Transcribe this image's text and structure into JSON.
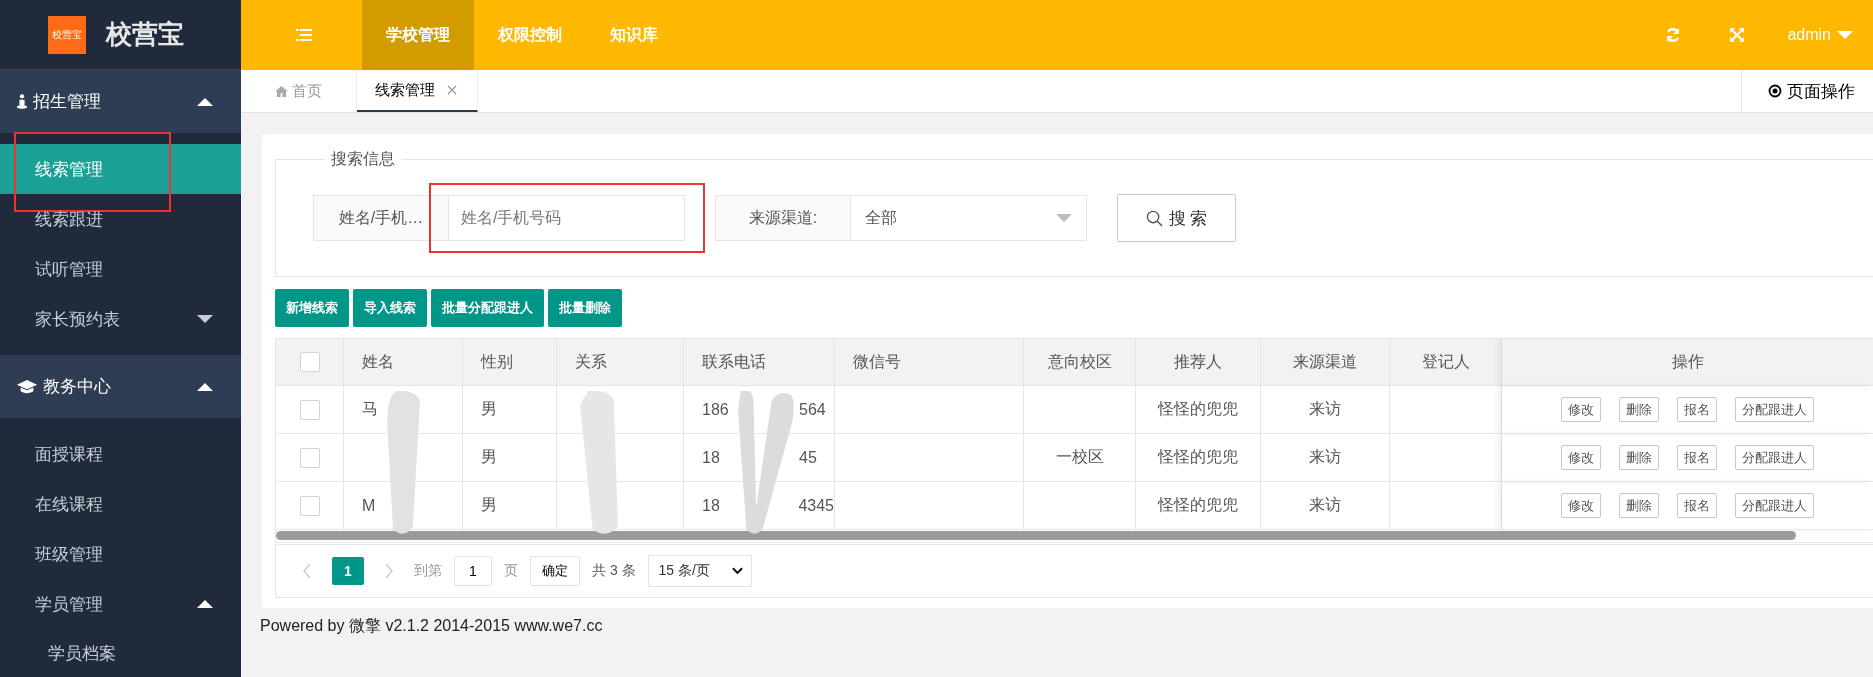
{
  "logo": {
    "badge": "校营宝",
    "title": "校营宝"
  },
  "sidebar": {
    "groups": [
      {
        "label": "招生管理",
        "expanded": true,
        "items": [
          {
            "label": "线索管理",
            "selected": true,
            "highlighted": true
          },
          {
            "label": "线索跟进",
            "selected": false
          },
          {
            "label": "试听管理",
            "selected": false
          },
          {
            "label": "家长预约表",
            "selected": false,
            "expanded": false
          }
        ]
      },
      {
        "label": "教务中心",
        "expanded": true,
        "items": [
          {
            "label": "面授课程",
            "selected": false
          },
          {
            "label": "在线课程",
            "selected": false
          },
          {
            "label": "班级管理",
            "selected": false
          },
          {
            "label": "学员管理",
            "selected": false,
            "expanded": true,
            "children": [
              {
                "label": "学员档案",
                "selected": false
              }
            ]
          }
        ]
      }
    ]
  },
  "top_nav": {
    "items": [
      {
        "label": "学校管理",
        "selected": true
      },
      {
        "label": "权限控制",
        "selected": false
      },
      {
        "label": "知识库",
        "selected": false
      }
    ],
    "user": "admin"
  },
  "tabs": [
    {
      "label": "首页",
      "selected": false,
      "closable": false
    },
    {
      "label": "线索管理",
      "selected": true,
      "closable": true
    }
  ],
  "page_actions": "页面操作",
  "search": {
    "legend": "搜索信息",
    "name_label": "姓名/手机…",
    "name_placeholder": "姓名/手机号码",
    "name_highlighted": true,
    "source_label": "来源渠道:",
    "source_value": "全部",
    "button": "搜 索"
  },
  "actions": [
    "新增线索",
    "导入线索",
    "批量分配跟进人",
    "批量删除"
  ],
  "table": {
    "all_checked": false,
    "columns": [
      "姓名",
      "性别",
      "关系",
      "联系电话",
      "微信号",
      "意向校区",
      "推荐人",
      "来源渠道",
      "登记人",
      "操作"
    ],
    "rows": [
      {
        "checked": false,
        "name": "马",
        "gender": "男",
        "phone_head": "186",
        "phone_tail": "564",
        "referrer": "怪怪的兜兜",
        "source": "来访",
        "ops": [
          "修改",
          "删除",
          "报名",
          "分配跟进人"
        ]
      },
      {
        "checked": false,
        "gender": "男",
        "phone_head": "18",
        "phone_tail": "45",
        "campus": "一校区",
        "referrer": "怪怪的兜兜",
        "source": "来访",
        "ops": [
          "修改",
          "删除",
          "报名",
          "分配跟进人"
        ]
      },
      {
        "checked": false,
        "name": "M",
        "gender": "男",
        "phone_head": "18",
        "phone_tail": "4345",
        "referrer": "怪怪的兜兜",
        "source": "来访",
        "ops": [
          "修改",
          "删除",
          "报名",
          "分配跟进人"
        ]
      }
    ]
  },
  "pagination": {
    "pages": [
      {
        "label": "1",
        "selected": true
      }
    ],
    "goto_label": "到第",
    "goto_value": "1",
    "page_unit": "页",
    "confirm": "确定",
    "total": "共 3 条",
    "page_size": "15 条/页"
  },
  "footer": "Powered by 微擎 v2.1.2 2014-2015 www.we7.cc"
}
